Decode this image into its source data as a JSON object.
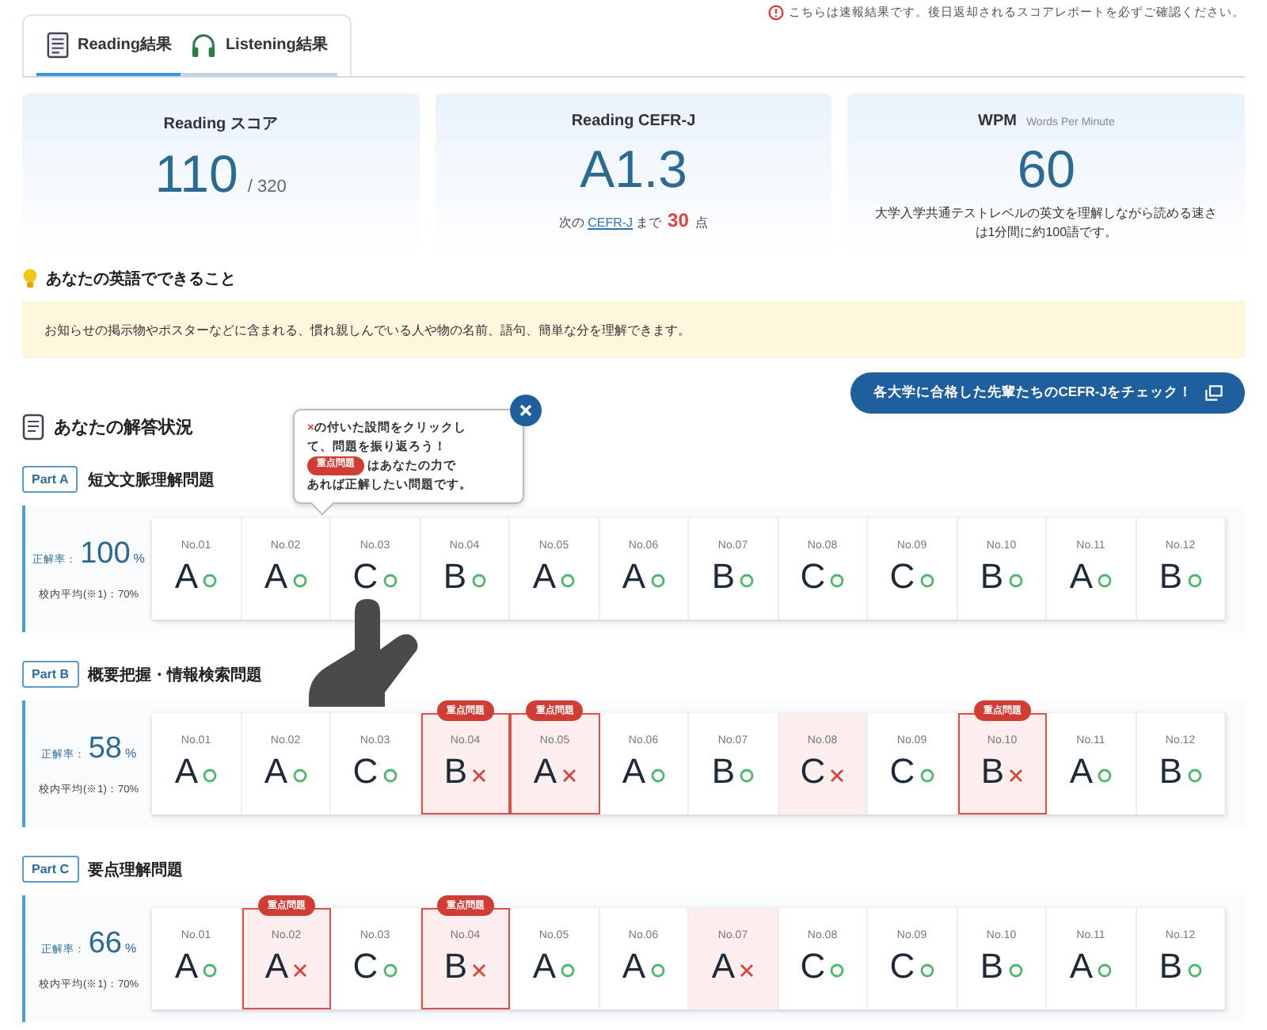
{
  "notice": "こちらは速報結果です。後日返却されるスコアレポートを必ずご確認ください。",
  "tabs": [
    {
      "label": "Reading結果",
      "kind": "book",
      "selected": true
    },
    {
      "label": "Listening結果",
      "kind": "headphones",
      "selected": false
    }
  ],
  "score_card": {
    "title": "Reading スコア",
    "value": "110",
    "total": "/ 320"
  },
  "cefr_card": {
    "title": "Reading CEFR-J",
    "value": "A1.3",
    "note_prefix": "次の",
    "note_link": "CEFR-J",
    "note_mid": "まで",
    "note_points": "30",
    "note_suffix": "点"
  },
  "wpm_card": {
    "title": "WPM",
    "subtitle": "Words Per Minute",
    "value": "60",
    "description": "大学入学共通テストレベルの英文を理解しながら読める速さは1分間に約100語です。"
  },
  "can_do": {
    "heading": "あなたの英語でできること",
    "text": "お知らせの掲示物やポスターなどに含まれる、慣れ親しんでいる人や物の名前、語句、簡単な分を理解できます。"
  },
  "senior_button": "各大学に合格した先輩たちのCEFR-Jをチェック！",
  "answers_heading": "あなたの解答状況",
  "tooltip": {
    "mark": "×",
    "line1": "の付いた設問をクリックし",
    "line2": "て、問題を振り返ろう！",
    "badge": "重点問題",
    "line3": "はあなたの力で",
    "line4": "あれば正解したい問題です。"
  },
  "parts": [
    {
      "label": "Part A",
      "title": "短文文脈理解問題",
      "accuracy_label": "正解率：",
      "accuracy": "100",
      "unit": "%",
      "average": "校内平均(※1)：70%",
      "questions": [
        {
          "no": "No.01",
          "answer": "A",
          "correct": true
        },
        {
          "no": "No.02",
          "answer": "A",
          "correct": true
        },
        {
          "no": "No.03",
          "answer": "C",
          "correct": true
        },
        {
          "no": "No.04",
          "answer": "B",
          "correct": true
        },
        {
          "no": "No.05",
          "answer": "A",
          "correct": true
        },
        {
          "no": "No.06",
          "answer": "A",
          "correct": true
        },
        {
          "no": "No.07",
          "answer": "B",
          "correct": true
        },
        {
          "no": "No.08",
          "answer": "C",
          "correct": true
        },
        {
          "no": "No.09",
          "answer": "C",
          "correct": true
        },
        {
          "no": "No.10",
          "answer": "B",
          "correct": true
        },
        {
          "no": "No.11",
          "answer": "A",
          "correct": true
        },
        {
          "no": "No.12",
          "answer": "B",
          "correct": true
        }
      ]
    },
    {
      "label": "Part B",
      "title": "概要把握・情報検索問題",
      "accuracy_label": "正解率：",
      "accuracy": "58",
      "unit": "%",
      "average": "校内平均(※1)：70%",
      "questions": [
        {
          "no": "No.01",
          "answer": "A",
          "correct": true
        },
        {
          "no": "No.02",
          "answer": "A",
          "correct": true
        },
        {
          "no": "No.03",
          "answer": "C",
          "correct": true
        },
        {
          "no": "No.04",
          "answer": "B",
          "correct": false,
          "badge": "重点問題"
        },
        {
          "no": "No.05",
          "answer": "A",
          "correct": false,
          "badge": "重点問題"
        },
        {
          "no": "No.06",
          "answer": "A",
          "correct": true
        },
        {
          "no": "No.07",
          "answer": "B",
          "correct": true
        },
        {
          "no": "No.08",
          "answer": "C",
          "correct": false
        },
        {
          "no": "No.09",
          "answer": "C",
          "correct": true
        },
        {
          "no": "No.10",
          "answer": "B",
          "correct": false,
          "badge": "重点問題"
        },
        {
          "no": "No.11",
          "answer": "A",
          "correct": true
        },
        {
          "no": "No.12",
          "answer": "B",
          "correct": true
        }
      ]
    },
    {
      "label": "Part C",
      "title": "要点理解問題",
      "accuracy_label": "正解率：",
      "accuracy": "66",
      "unit": "%",
      "average": "校内平均(※1)：70%",
      "questions": [
        {
          "no": "No.01",
          "answer": "A",
          "correct": true
        },
        {
          "no": "No.02",
          "answer": "A",
          "correct": false,
          "badge": "重点問題"
        },
        {
          "no": "No.03",
          "answer": "C",
          "correct": true
        },
        {
          "no": "No.04",
          "answer": "B",
          "correct": false,
          "badge": "重点問題"
        },
        {
          "no": "No.05",
          "answer": "A",
          "correct": true
        },
        {
          "no": "No.06",
          "answer": "A",
          "correct": true
        },
        {
          "no": "No.07",
          "answer": "A",
          "correct": false
        },
        {
          "no": "No.08",
          "answer": "C",
          "correct": true
        },
        {
          "no": "No.09",
          "answer": "C",
          "correct": true
        },
        {
          "no": "No.10",
          "answer": "B",
          "correct": true
        },
        {
          "no": "No.11",
          "answer": "A",
          "correct": true
        },
        {
          "no": "No.12",
          "answer": "B",
          "correct": true
        }
      ]
    }
  ]
}
